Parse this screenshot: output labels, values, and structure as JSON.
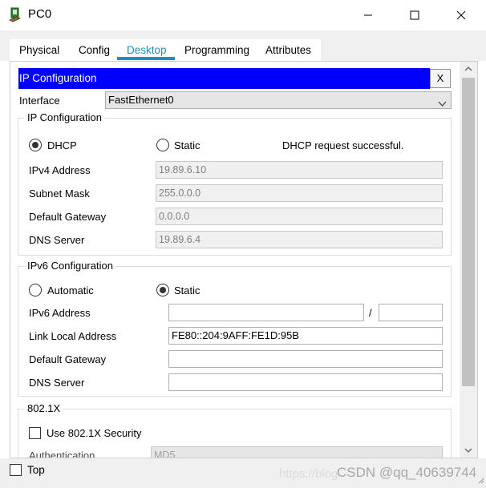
{
  "window": {
    "title": "PC0",
    "icon": "pc-icon"
  },
  "tabs": [
    {
      "label": "Physical",
      "active": false
    },
    {
      "label": "Config",
      "active": false
    },
    {
      "label": "Desktop",
      "active": true
    },
    {
      "label": "Programming",
      "active": false
    },
    {
      "label": "Attributes",
      "active": false
    }
  ],
  "ip_config": {
    "header": "IP Configuration",
    "close_label": "X",
    "interface_label": "Interface",
    "interface_value": "FastEthernet0",
    "ipv4_group": {
      "title": "IP Configuration",
      "dhcp_label": "DHCP",
      "static_label": "Static",
      "mode": "DHCP",
      "status": "DHCP request successful.",
      "ipv4_label": "IPv4 Address",
      "ipv4_value": "19.89.6.10",
      "mask_label": "Subnet Mask",
      "mask_value": "255.0.0.0",
      "gateway_label": "Default Gateway",
      "gateway_value": "0.0.0.0",
      "dns_label": "DNS Server",
      "dns_value": "19.89.6.4"
    },
    "ipv6_group": {
      "title": "IPv6 Configuration",
      "automatic_label": "Automatic",
      "static_label": "Static",
      "mode": "Static",
      "ipv6_label": "IPv6 Address",
      "ipv6_value": "",
      "slash": "/",
      "prefix_value": "",
      "link_local_label": "Link Local Address",
      "link_local_value": "FE80::204:9AFF:FE1D:95B",
      "gateway_label": "Default Gateway",
      "gateway_value": "",
      "dns_label": "DNS Server",
      "dns_value": ""
    },
    "dot1x_group": {
      "title": "802.1X",
      "use_security_label": "Use 802.1X Security",
      "use_security_checked": false,
      "auth_label": "Authentication",
      "auth_value": "MD5"
    }
  },
  "footer": {
    "top_label": "Top",
    "top_checked": false,
    "watermark_url": "https://blog",
    "watermark_text": "CSDN @qq_40639744"
  },
  "colors": {
    "accent": "#1a8fc9",
    "header_bg": "#0000ff"
  }
}
